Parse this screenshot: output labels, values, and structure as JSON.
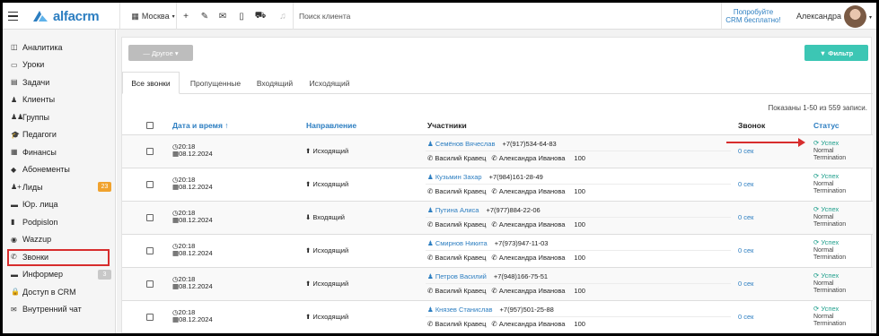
{
  "brand": {
    "name": "alfacrm",
    "color": "#2c7ec1"
  },
  "topbar": {
    "city": "Москва",
    "search_placeholder": "Поиск клиента",
    "promo_line1": "Попробуйте",
    "promo_line2": "CRM бесплатно!",
    "user_name": "Александра",
    "icons": [
      "menu-icon",
      "plus-icon",
      "wrench-icon",
      "mail-icon",
      "phone-icon",
      "cart-icon",
      "bell-icon"
    ]
  },
  "sidebar": {
    "items": [
      {
        "label": "Аналитика",
        "icon": "◫"
      },
      {
        "label": "Уроки",
        "icon": "▭"
      },
      {
        "label": "Задачи",
        "icon": "▤"
      },
      {
        "label": "Клиенты",
        "icon": "♟"
      },
      {
        "label": "Группы",
        "icon": "♟♟"
      },
      {
        "label": "Педагоги",
        "icon": "🎓"
      },
      {
        "label": "Финансы",
        "icon": "▦"
      },
      {
        "label": "Абонементы",
        "icon": "◆"
      },
      {
        "label": "Лиды",
        "icon": "♟+",
        "badge": "23",
        "badge_color": "#f0a22e"
      },
      {
        "label": "Юр. лица",
        "icon": "▬"
      },
      {
        "label": "Podpislon",
        "icon": "▮"
      },
      {
        "label": "Wazzup",
        "icon": "◉"
      },
      {
        "label": "Звонки",
        "icon": "✆"
      },
      {
        "label": "Информер",
        "icon": "▬",
        "badge": "3",
        "badge_color": "#c8c8c8"
      },
      {
        "label": "Доступ в CRM",
        "icon": "🔒"
      },
      {
        "label": "Внутренний чат",
        "icon": "✉"
      }
    ]
  },
  "toolbar": {
    "other_label": "— Другое ▾",
    "filter_label": "▼ Фильтр",
    "filter_color": "#3cc6b4"
  },
  "tabs": [
    "Все звонки",
    "Пропущенные",
    "Входящий",
    "Исходящий"
  ],
  "shown_text": "Показаны 1-50 из 559 записи.",
  "table": {
    "headers": [
      "Дата и время ↑",
      "Направление",
      "Участники",
      "Звонок",
      "Статус"
    ],
    "rows": [
      {
        "time": "20:18",
        "date": "08.12.2024",
        "direction": "⬆ Исходящий",
        "client": "Семёнов Вячеслав",
        "phone": "+7(917)534-64-83",
        "from": "Василий Кравец",
        "to": "Александра Иванова",
        "ext": "100",
        "duration": "0 сек",
        "status": "Успех",
        "status2": "Normal",
        "status3": "Termination"
      },
      {
        "time": "20:18",
        "date": "08.12.2024",
        "direction": "⬆ Исходящий",
        "client": "Кузьмин Захар",
        "phone": "+7(984)161-28-49",
        "from": "Василий Кравец",
        "to": "Александра Иванова",
        "ext": "100",
        "duration": "0 сек",
        "status": "Успех",
        "status2": "Normal",
        "status3": "Termination"
      },
      {
        "time": "20:18",
        "date": "08.12.2024",
        "direction": "⬇ Входящий",
        "client": "Путина Алиса",
        "phone": "+7(977)884-22-06",
        "from": "Василий Кравец",
        "to": "Александра Иванова",
        "ext": "100",
        "duration": "0 сек",
        "status": "Успех",
        "status2": "Normal",
        "status3": "Termination"
      },
      {
        "time": "20:18",
        "date": "08.12.2024",
        "direction": "⬆ Исходящий",
        "client": "Смирнов Никита",
        "phone": "+7(973)947-11-03",
        "from": "Василий Кравец",
        "to": "Александра Иванова",
        "ext": "100",
        "duration": "0 сек",
        "status": "Успех",
        "status2": "Normal",
        "status3": "Termination"
      },
      {
        "time": "20:18",
        "date": "08.12.2024",
        "direction": "⬆ Исходящий",
        "client": "Петров Василий",
        "phone": "+7(948)166-75-51",
        "from": "Василий Кравец",
        "to": "Александра Иванова",
        "ext": "100",
        "duration": "0 сек",
        "status": "Успех",
        "status2": "Normal",
        "status3": "Termination"
      },
      {
        "time": "20:18",
        "date": "08.12.2024",
        "direction": "⬆ Исходящий",
        "client": "Князев Станислав",
        "phone": "+7(957)501-25-88",
        "from": "Василий Кравец",
        "to": "Александра Иванова",
        "ext": "100",
        "duration": "0 сек",
        "status": "Успех",
        "status2": "Normal",
        "status3": "Termination"
      }
    ]
  },
  "highlight_color": "#d72d2d"
}
